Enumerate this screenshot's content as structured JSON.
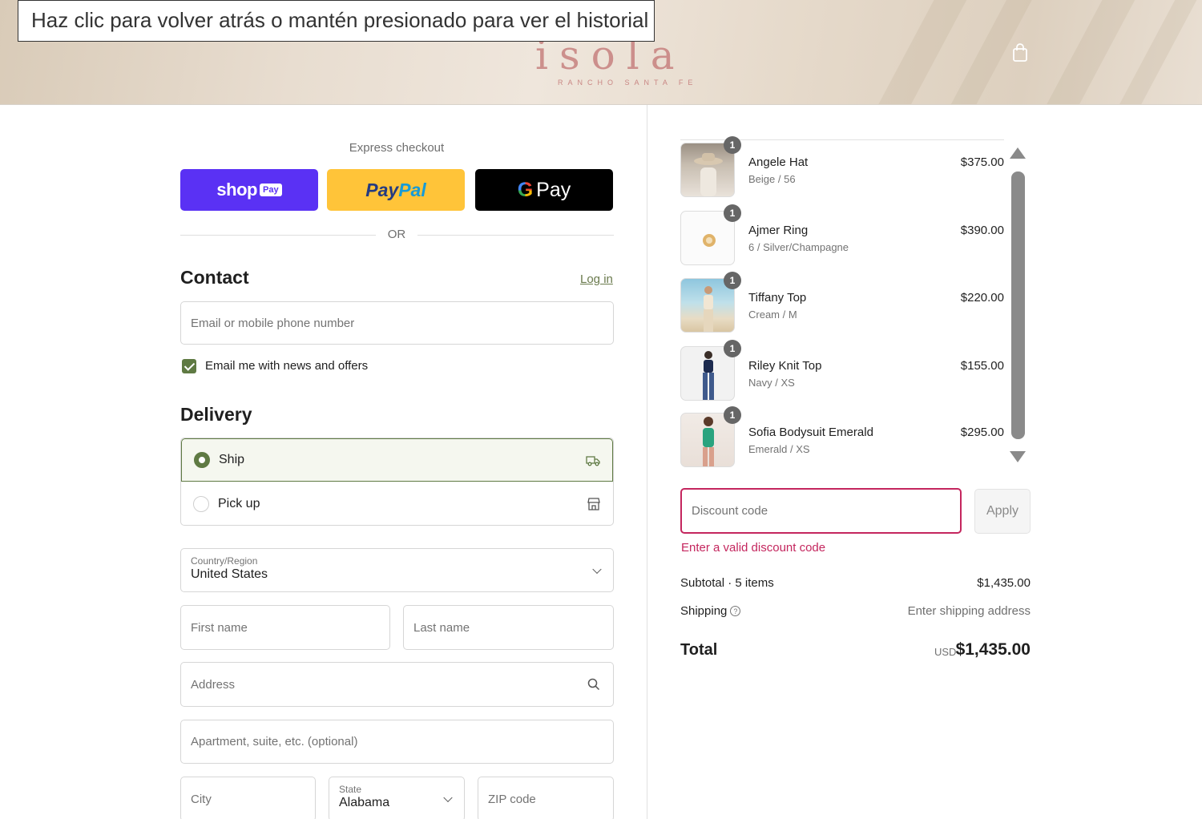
{
  "browser": {
    "tooltip": "Haz clic para volver atrás o mantén presionado para ver el historial"
  },
  "header": {
    "logo": "isola",
    "logo_sub": "RANCHO SANTA FE",
    "cart_icon": "shopping-bag-icon"
  },
  "express": {
    "label": "Express checkout",
    "shop_pay": {
      "text": "shop",
      "badge": "Pay",
      "color": "#5a31f4"
    },
    "paypal": {
      "part1": "Pay",
      "part2": "Pal",
      "color": "#ffc439"
    },
    "gpay": {
      "g": "G",
      "text": "Pay",
      "color": "#000000"
    },
    "or": "OR"
  },
  "contact": {
    "title": "Contact",
    "login": "Log in",
    "email_placeholder": "Email or mobile phone number",
    "newsletter_label": "Email me with news and offers",
    "newsletter_checked": true
  },
  "delivery": {
    "title": "Delivery",
    "options": [
      {
        "label": "Ship",
        "selected": true,
        "icon": "truck-icon"
      },
      {
        "label": "Pick up",
        "selected": false,
        "icon": "store-icon"
      }
    ],
    "country": {
      "label": "Country/Region",
      "value": "United States"
    },
    "first_name_placeholder": "First name",
    "last_name_placeholder": "Last name",
    "address_placeholder": "Address",
    "apartment_placeholder": "Apartment, suite, etc. (optional)",
    "city_placeholder": "City",
    "state": {
      "label": "State",
      "value": "Alabama"
    },
    "zip_placeholder": "ZIP code"
  },
  "cart": {
    "items": [
      {
        "qty": "1",
        "name": "Angele Hat",
        "variant": "Beige / 56",
        "price": "$375.00"
      },
      {
        "qty": "1",
        "name": "Ajmer Ring",
        "variant": "6 / Silver/Champagne",
        "price": "$390.00"
      },
      {
        "qty": "1",
        "name": "Tiffany Top",
        "variant": "Cream / M",
        "price": "$220.00"
      },
      {
        "qty": "1",
        "name": "Riley Knit Top",
        "variant": "Navy / XS",
        "price": "$155.00"
      },
      {
        "qty": "1",
        "name": "Sofia Bodysuit Emerald",
        "variant": "Emerald / XS",
        "price": "$295.00"
      }
    ],
    "discount_placeholder": "Discount code",
    "apply": "Apply",
    "discount_error": "Enter a valid discount code",
    "subtotal_label": "Subtotal · 5 items",
    "subtotal_value": "$1,435.00",
    "shipping_label": "Shipping",
    "shipping_value": "Enter shipping address",
    "total_label": "Total",
    "currency": "USD",
    "total_value": "$1,435.00",
    "error_color": "#c4265e",
    "accent_color": "#5f7a43"
  }
}
